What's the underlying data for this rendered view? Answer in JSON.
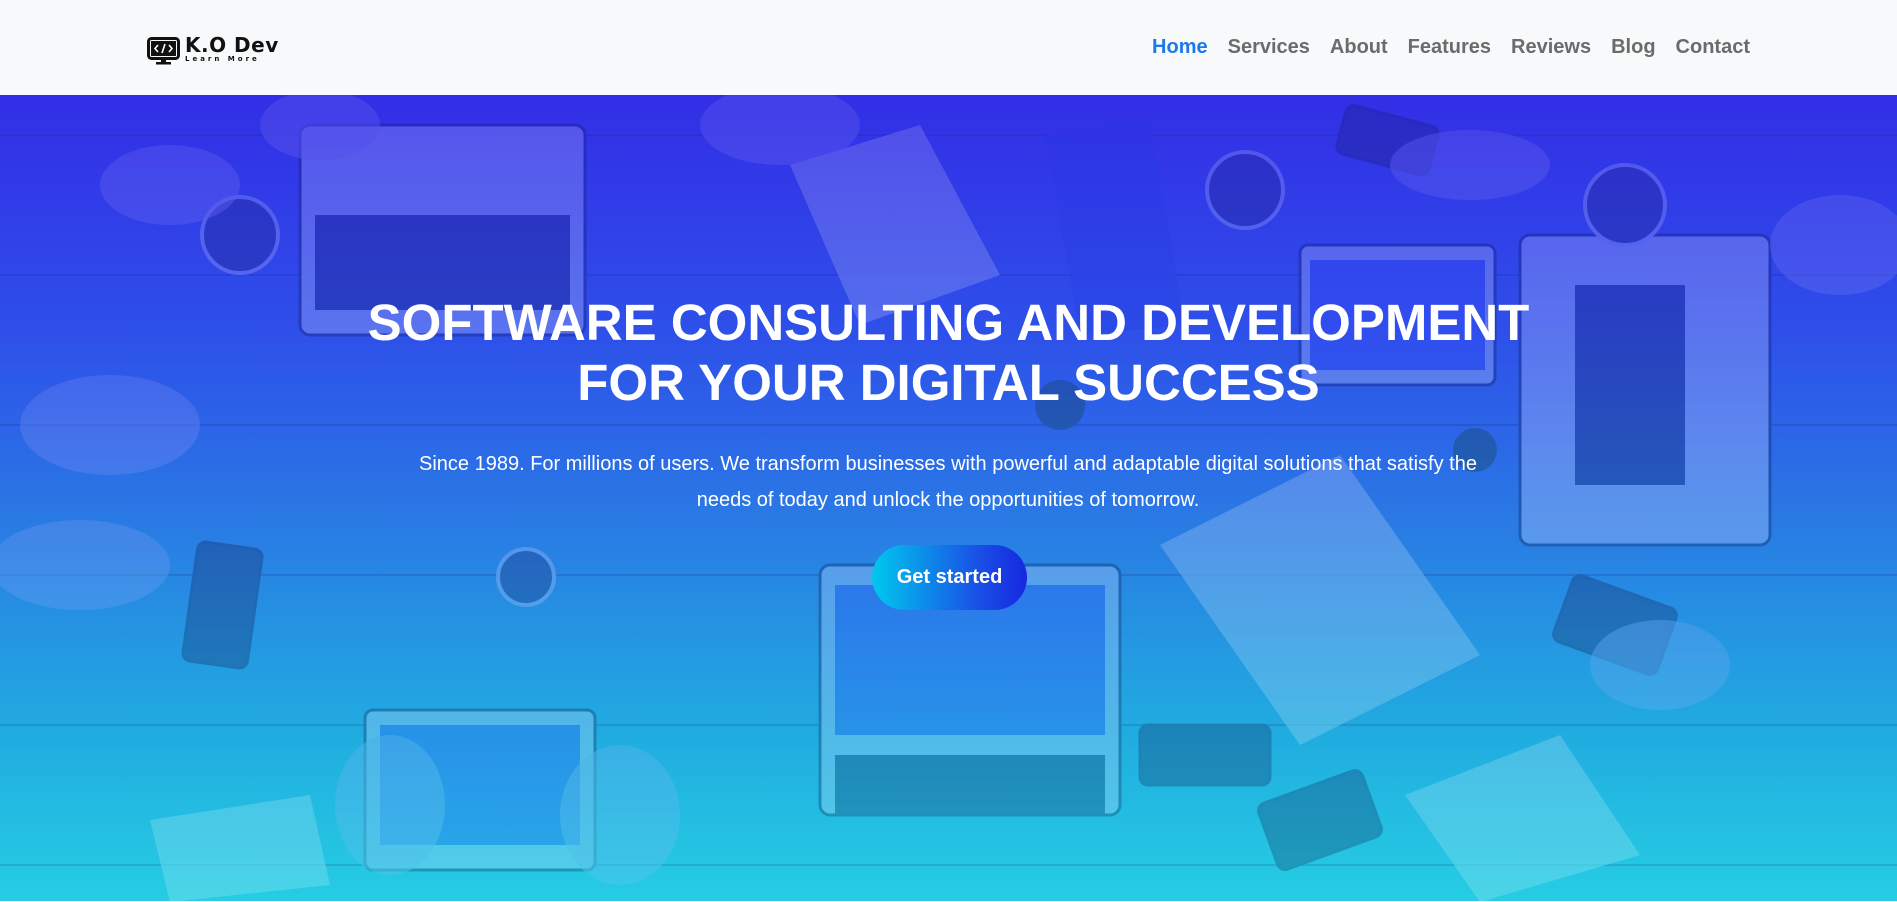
{
  "brand": {
    "name": "K.O Dev",
    "tagline": "Learn More"
  },
  "nav": {
    "items": [
      {
        "label": "Home",
        "active": true
      },
      {
        "label": "Services",
        "active": false
      },
      {
        "label": "About",
        "active": false
      },
      {
        "label": "Features",
        "active": false
      },
      {
        "label": "Reviews",
        "active": false
      },
      {
        "label": "Blog",
        "active": false
      },
      {
        "label": "Contact",
        "active": false
      }
    ]
  },
  "hero": {
    "title_line1": "SOFTWARE CONSULTING AND DEVELOPMENT",
    "title_line2": "FOR YOUR DIGITAL SUCCESS",
    "subtitle_line1": "Since 1989. For millions of users. We transform businesses with powerful and adaptable digital solutions that satisfy the",
    "subtitle_line2": "needs of today and unlock the opportunities of tomorrow.",
    "cta_label": "Get started"
  },
  "colors": {
    "nav_active": "#1e78e6",
    "nav_text": "#6b6b6b",
    "header_bg": "#f8f9fa",
    "hero_top": "#3434e6",
    "hero_bottom": "#2ad0e4"
  },
  "icons": {
    "logo": "monitor-code-icon"
  }
}
